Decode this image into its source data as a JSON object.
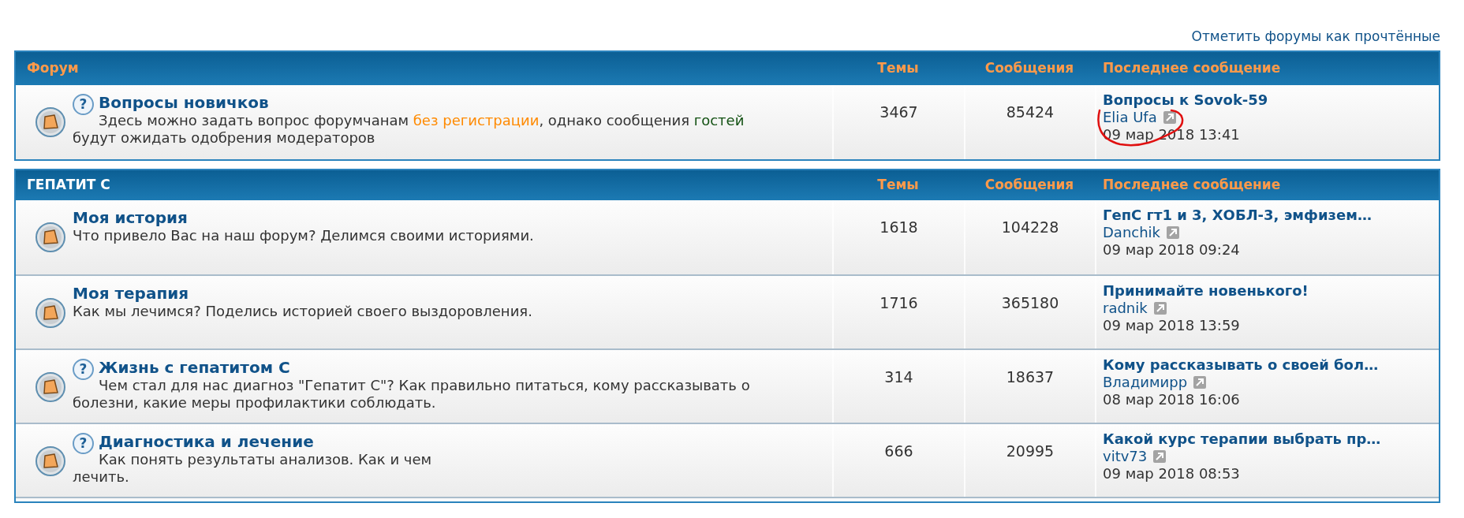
{
  "mark_read_link": "Отметить форумы как прочтённые",
  "sections": [
    {
      "columns": [
        "Форум",
        "Темы",
        "Сообщения",
        "Последнее сообщение"
      ],
      "forums": [
        {
          "help_icon": "?",
          "title": "Вопросы новичков",
          "description": [
            {
              "kind": "text",
              "text": "Здесь можно задать вопрос форумчанам "
            },
            {
              "kind": "link",
              "text": "без регистрации"
            },
            {
              "kind": "text",
              "text": ", однако сообщения "
            },
            {
              "kind": "guest",
              "text": "гостей"
            },
            {
              "kind": "text",
              "text": " будут ожидать одобрения модераторов"
            }
          ],
          "topics": "3467",
          "posts": "85424",
          "last_post": {
            "title": "Вопросы к Sovok-59",
            "author": "Elia Ufa",
            "date": "09 мар 2018 13:41"
          }
        }
      ]
    },
    {
      "columns": [
        "ГЕПАТИТ С",
        "Темы",
        "Сообщения",
        "Последнее сообщение"
      ],
      "forums": [
        {
          "title": "Моя история",
          "description": [
            {
              "kind": "text",
              "text": "Что привело Вас на наш форум? Делимся своими историями."
            }
          ],
          "topics": "1618",
          "posts": "104228",
          "last_post": {
            "title": "ГепС гт1 и 3, ХОБЛ-3, эмфизем…",
            "author": "Danchik",
            "date": "09 мар 2018 09:24"
          }
        },
        {
          "title": "Моя терапия",
          "description": [
            {
              "kind": "text",
              "text": "Как мы лечимся? Поделись историей своего выздоровления."
            }
          ],
          "topics": "1716",
          "posts": "365180",
          "last_post": {
            "title": "Принимайте новенького!",
            "author": "radnik",
            "date": "09 мар 2018 13:59"
          }
        },
        {
          "help_icon": "?",
          "title": "Жизнь с гепатитом С",
          "description": [
            {
              "kind": "text",
              "text": "Чем стал для нас диагноз \"Гепатит С\"? Как правильно питаться, кому рассказывать о болезни, какие меры профилактики соблюдать."
            }
          ],
          "topics": "314",
          "posts": "18637",
          "last_post": {
            "title": "Кому рассказывать о своей бол…",
            "author": "Владимирр",
            "date": "08 мар 2018 16:06"
          }
        },
        {
          "help_icon": "?",
          "title": "Диагностика и лечение",
          "description": [
            {
              "kind": "text",
              "text": "Как понять результаты анализов. Как и чем лечить."
            }
          ],
          "topics": "666",
          "posts": "20995",
          "last_post": {
            "title": "Какой курс терапии выбрать пр…",
            "author": "vitv73",
            "date": "09 мар 2018 08:53"
          }
        }
      ]
    }
  ]
}
